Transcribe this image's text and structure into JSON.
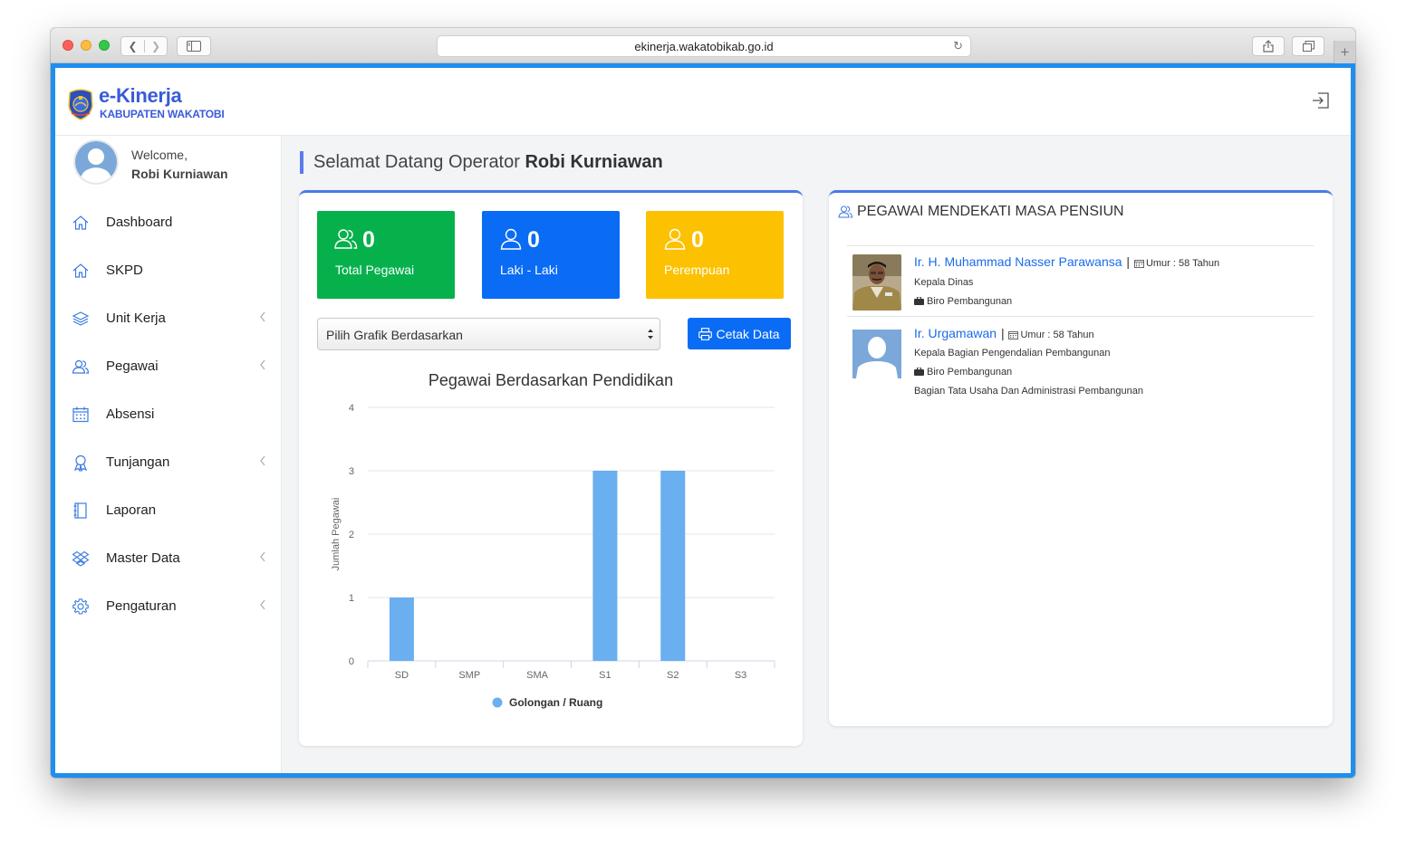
{
  "browser": {
    "url": "ekinerja.wakatobikab.go.id"
  },
  "brand": {
    "title": "e-Kinerja",
    "subtitle": "KABUPATEN WAKATOBI"
  },
  "user": {
    "welcome": "Welcome,",
    "name": "Robi Kurniawan"
  },
  "sidebar": {
    "items": [
      {
        "label": "Dashboard",
        "icon": "home-icon",
        "submenu": false
      },
      {
        "label": "SKPD",
        "icon": "home-icon",
        "submenu": false
      },
      {
        "label": "Unit Kerja",
        "icon": "layers-icon",
        "submenu": true
      },
      {
        "label": "Pegawai",
        "icon": "users-icon",
        "submenu": true
      },
      {
        "label": "Absensi",
        "icon": "calendar-icon",
        "submenu": false
      },
      {
        "label": "Tunjangan",
        "icon": "award-icon",
        "submenu": true
      },
      {
        "label": "Laporan",
        "icon": "notebook-icon",
        "submenu": false
      },
      {
        "label": "Master Data",
        "icon": "dropbox-icon",
        "submenu": true
      },
      {
        "label": "Pengaturan",
        "icon": "gear-icon",
        "submenu": true
      }
    ]
  },
  "main": {
    "title_prefix": "Selamat Datang Operator",
    "title_name": "Robi Kurniawan",
    "stats": [
      {
        "value": "0",
        "label": "Total Pegawai",
        "color": "#06b14c"
      },
      {
        "value": "0",
        "label": "Laki - Laki",
        "color": "#0a6cf5"
      },
      {
        "value": "0",
        "label": "Perempuan",
        "color": "#fcc100"
      }
    ],
    "select_value": "Pilih Grafik Berdasarkan",
    "print_label": "Cetak Data"
  },
  "chart_data": {
    "type": "bar",
    "title": "Pegawai Berdasarkan Pendidikan",
    "categories": [
      "SD",
      "SMP",
      "SMA",
      "S1",
      "S2",
      "S3"
    ],
    "series": [
      {
        "name": "Golongan / Ruang",
        "values": [
          1,
          0,
          0,
          3,
          3,
          0
        ],
        "color": "#6aaff0"
      }
    ],
    "xlabel": "",
    "ylabel": "Jumlah Pegawai",
    "ylim": [
      0,
      4
    ],
    "yticks": [
      0,
      1,
      2,
      3,
      4
    ],
    "grid": true,
    "legend": "bottom-center"
  },
  "retirement": {
    "title": "PEGAWAI MENDEKATI MASA PENSIUN",
    "employees": [
      {
        "name": "Ir. H. Muhammad Nasser Parawansa",
        "sep": "|",
        "age": "Umur : 58 Tahun",
        "position": "Kepala Dinas",
        "unit": "Biro Pembangunan",
        "subunit": ""
      },
      {
        "name": "Ir. Urgamawan",
        "sep": "|",
        "age": "Umur : 58 Tahun",
        "position": "Kepala Bagian Pengendalian Pembangunan",
        "unit": "Biro Pembangunan",
        "subunit": "Bagian Tata Usaha Dan Administrasi Pembangunan"
      }
    ]
  }
}
